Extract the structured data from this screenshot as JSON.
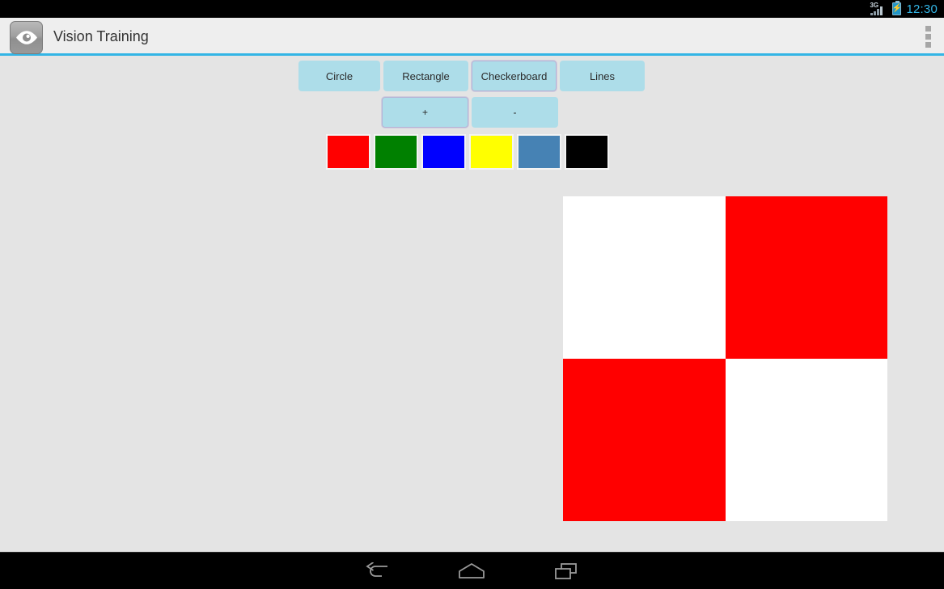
{
  "status_bar": {
    "network_label": "3G",
    "signal_icon": "signal-bars-icon",
    "battery_icon": "battery-charging-icon",
    "time": "12:30",
    "accent_color": "#33b5e5"
  },
  "action_bar": {
    "app_icon": "eye-icon",
    "title": "Vision Training",
    "overflow_icon": "overflow-menu-icon",
    "background": "#eeeeee",
    "divider_color": "#33b5e5"
  },
  "controls": {
    "shape_buttons": [
      {
        "label": "Circle",
        "name": "circle-button",
        "focused": false
      },
      {
        "label": "Rectangle",
        "name": "rectangle-button",
        "focused": false
      },
      {
        "label": "Checkerboard",
        "name": "checkerboard-button",
        "focused": true
      },
      {
        "label": "Lines",
        "name": "lines-button",
        "focused": false
      }
    ],
    "zoom_buttons": [
      {
        "label": "+",
        "name": "increase-size-button",
        "focused": true
      },
      {
        "label": "-",
        "name": "decrease-size-button",
        "focused": false
      }
    ],
    "button_color": "#addde9",
    "focus_border_color": "#b7b3d6",
    "color_swatches": [
      {
        "name": "color-swatch-red",
        "color": "#ff0000"
      },
      {
        "name": "color-swatch-green",
        "color": "#008000"
      },
      {
        "name": "color-swatch-blue",
        "color": "#0000ff"
      },
      {
        "name": "color-swatch-yellow",
        "color": "#ffff00"
      },
      {
        "name": "color-swatch-steelblue",
        "color": "#4682b4"
      },
      {
        "name": "color-swatch-black",
        "color": "#000000"
      }
    ]
  },
  "pattern": {
    "type": "checkerboard",
    "rows": 2,
    "columns": 2,
    "cells": [
      {
        "name": "checker-cell-top-left",
        "color": "#ffffff"
      },
      {
        "name": "checker-cell-top-right",
        "color": "#ff0000"
      },
      {
        "name": "checker-cell-bottom-left",
        "color": "#ff0000"
      },
      {
        "name": "checker-cell-bottom-right",
        "color": "#ffffff"
      }
    ]
  },
  "navigation_bar": {
    "back_icon": "back-arrow-icon",
    "home_icon": "home-icon",
    "recent_icon": "recent-apps-icon"
  },
  "background_color": "#e4e4e4"
}
